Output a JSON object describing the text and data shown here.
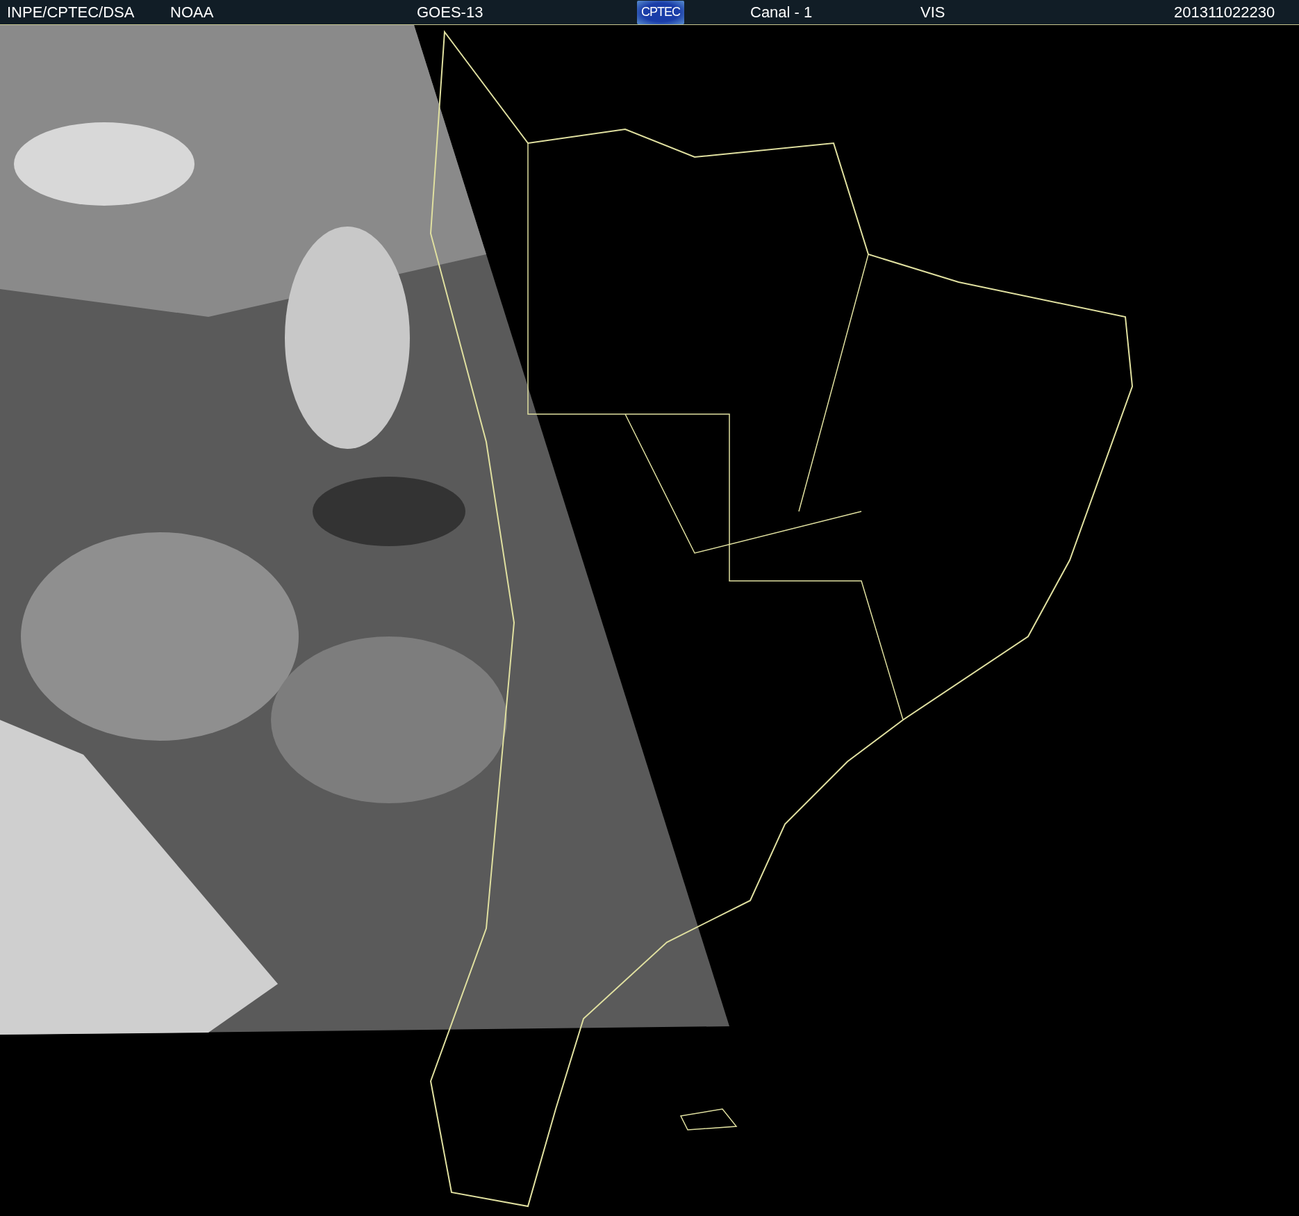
{
  "header": {
    "agency": "INPE/CPTEC/DSA",
    "source": "NOAA",
    "satellite": "GOES-13",
    "logo_text": "CPTEC",
    "channel": "Canal - 1",
    "band": "VIS",
    "timestamp": "201311022230"
  }
}
